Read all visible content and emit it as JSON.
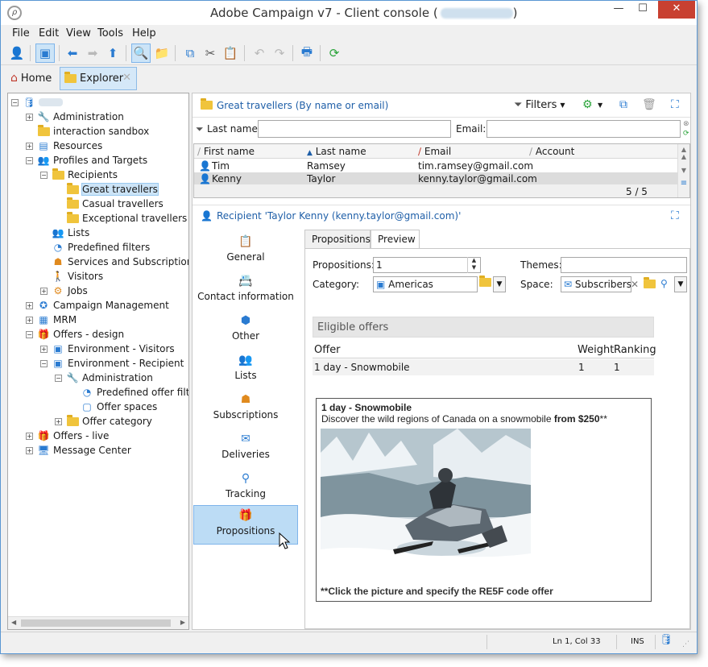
{
  "window": {
    "title": "Adobe Campaign v7 - Client console (",
    "title_suffix": ")",
    "controls": {
      "minimize": "—",
      "maximize": "☐",
      "close": "✕"
    }
  },
  "menu": [
    "File",
    "Edit",
    "View",
    "Tools",
    "Help"
  ],
  "tabs": {
    "home": "Home",
    "explorer": "Explorer"
  },
  "tree": [
    {
      "label": "Administration",
      "icon": "wrench-icon"
    },
    {
      "label": "interaction sandbox",
      "icon": "folder-icon"
    },
    {
      "label": "Resources",
      "icon": "resources-icon"
    },
    {
      "label": "Profiles and Targets",
      "icon": "people-icon"
    },
    {
      "label": "Recipients",
      "icon": "recipients-folder-icon"
    },
    {
      "label": "Great travellers",
      "icon": "folder-icon"
    },
    {
      "label": "Casual travellers",
      "icon": "folder-icon"
    },
    {
      "label": "Exceptional travellers",
      "icon": "folder-icon"
    },
    {
      "label": "Lists",
      "icon": "lists-icon"
    },
    {
      "label": "Predefined filters",
      "icon": "filter-icon"
    },
    {
      "label": "Services and Subscriptions",
      "icon": "services-icon"
    },
    {
      "label": "Visitors",
      "icon": "visitor-icon"
    },
    {
      "label": "Jobs",
      "icon": "gear-icon"
    },
    {
      "label": "Campaign Management",
      "icon": "campaign-icon"
    },
    {
      "label": "MRM",
      "icon": "mrm-icon"
    },
    {
      "label": "Offers - design",
      "icon": "gift-icon"
    },
    {
      "label": "Environment - Visitors",
      "icon": "environment-icon"
    },
    {
      "label": "Environment - Recipient",
      "icon": "environment-icon"
    },
    {
      "label": "Administration",
      "icon": "wrench-icon"
    },
    {
      "label": "Predefined offer filter",
      "icon": "filter-icon"
    },
    {
      "label": "Offer spaces",
      "icon": "offer-space-icon"
    },
    {
      "label": "Offer category",
      "icon": "folder-icon"
    },
    {
      "label": "Offers - live",
      "icon": "gift-icon"
    },
    {
      "label": "Message Center",
      "icon": "message-center-icon"
    }
  ],
  "list": {
    "title": "Great travellers (By name or email)",
    "filters_label": "Filters",
    "last_name_label": "Last name:",
    "email_label": "Email:",
    "columns": [
      "First name",
      "Last name",
      "Email",
      "Account"
    ],
    "rows": [
      {
        "first": "Tim",
        "last": "Ramsey",
        "email": "tim.ramsey@gmail.com"
      },
      {
        "first": "Kenny",
        "last": "Taylor",
        "email": "kenny.taylor@gmail.com"
      }
    ],
    "count": "5 / 5"
  },
  "detail": {
    "title": "Recipient 'Taylor Kenny (kenny.taylor@gmail.com)'",
    "nav": [
      "General",
      "Contact information",
      "Other",
      "Lists",
      "Subscriptions",
      "Deliveries",
      "Tracking",
      "Propositions"
    ],
    "tabs": [
      "Propositions",
      "Preview"
    ],
    "propositions_label": "Propositions:",
    "propositions_value": "1",
    "themes_label": "Themes:",
    "category_label": "Category:",
    "category_value": "Americas",
    "space_label": "Space:",
    "space_value": "Subscribers j",
    "eligible_title": "Eligible offers",
    "offers_columns": [
      "Offer",
      "Weight",
      "Ranking"
    ],
    "offer_row": {
      "offer": "1 day - Snowmobile",
      "weight": "1",
      "ranking": "1"
    },
    "preview": {
      "title": "1 day - Snowmobile",
      "description": "Discover the wild regions of Canada on a snowmobile ",
      "price": "from $250",
      "stars": "**",
      "footer": "**Click the picture and specify the RE5F code offer"
    }
  },
  "status": {
    "position": "Ln 1, Col 33",
    "mode": "INS"
  }
}
